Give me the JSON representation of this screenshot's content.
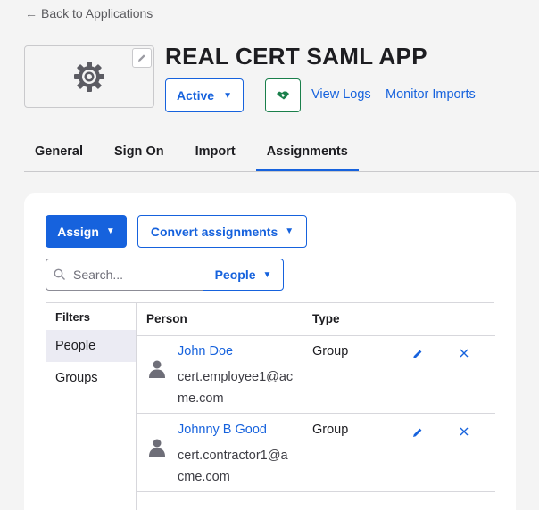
{
  "nav": {
    "back_label": "Back to Applications"
  },
  "app": {
    "title": "REAL CERT SAML APP",
    "status_label": "Active",
    "links": {
      "view_logs": "View Logs",
      "monitor_imports": "Monitor Imports"
    }
  },
  "tabs": [
    {
      "label": "General"
    },
    {
      "label": "Sign On"
    },
    {
      "label": "Import"
    },
    {
      "label": "Assignments",
      "active": true
    }
  ],
  "toolbar": {
    "assign_label": "Assign",
    "convert_label": "Convert assignments",
    "search_placeholder": "Search...",
    "filter_select": "People"
  },
  "filters": {
    "heading": "Filters",
    "items": [
      {
        "label": "People",
        "selected": true
      },
      {
        "label": "Groups"
      }
    ]
  },
  "table": {
    "columns": {
      "person": "Person",
      "type": "Type"
    },
    "rows": [
      {
        "name": "John Doe",
        "email": "cert.employee1@acme.com",
        "type": "Group"
      },
      {
        "name": "Johnny B Good",
        "email": "cert.contractor1@acme.com",
        "type": "Group"
      }
    ]
  },
  "colors": {
    "primary": "#1662dd",
    "success": "#1a7f4b",
    "text": "#1d1d21",
    "page_bg": "#f4f4f4"
  },
  "icons": {
    "logo": "gear-icon",
    "edit": "pencil-icon",
    "integration": "handshake-icon",
    "search": "search-icon",
    "avatar": "person-icon",
    "remove": "close-icon",
    "back": "arrow-left-icon"
  }
}
